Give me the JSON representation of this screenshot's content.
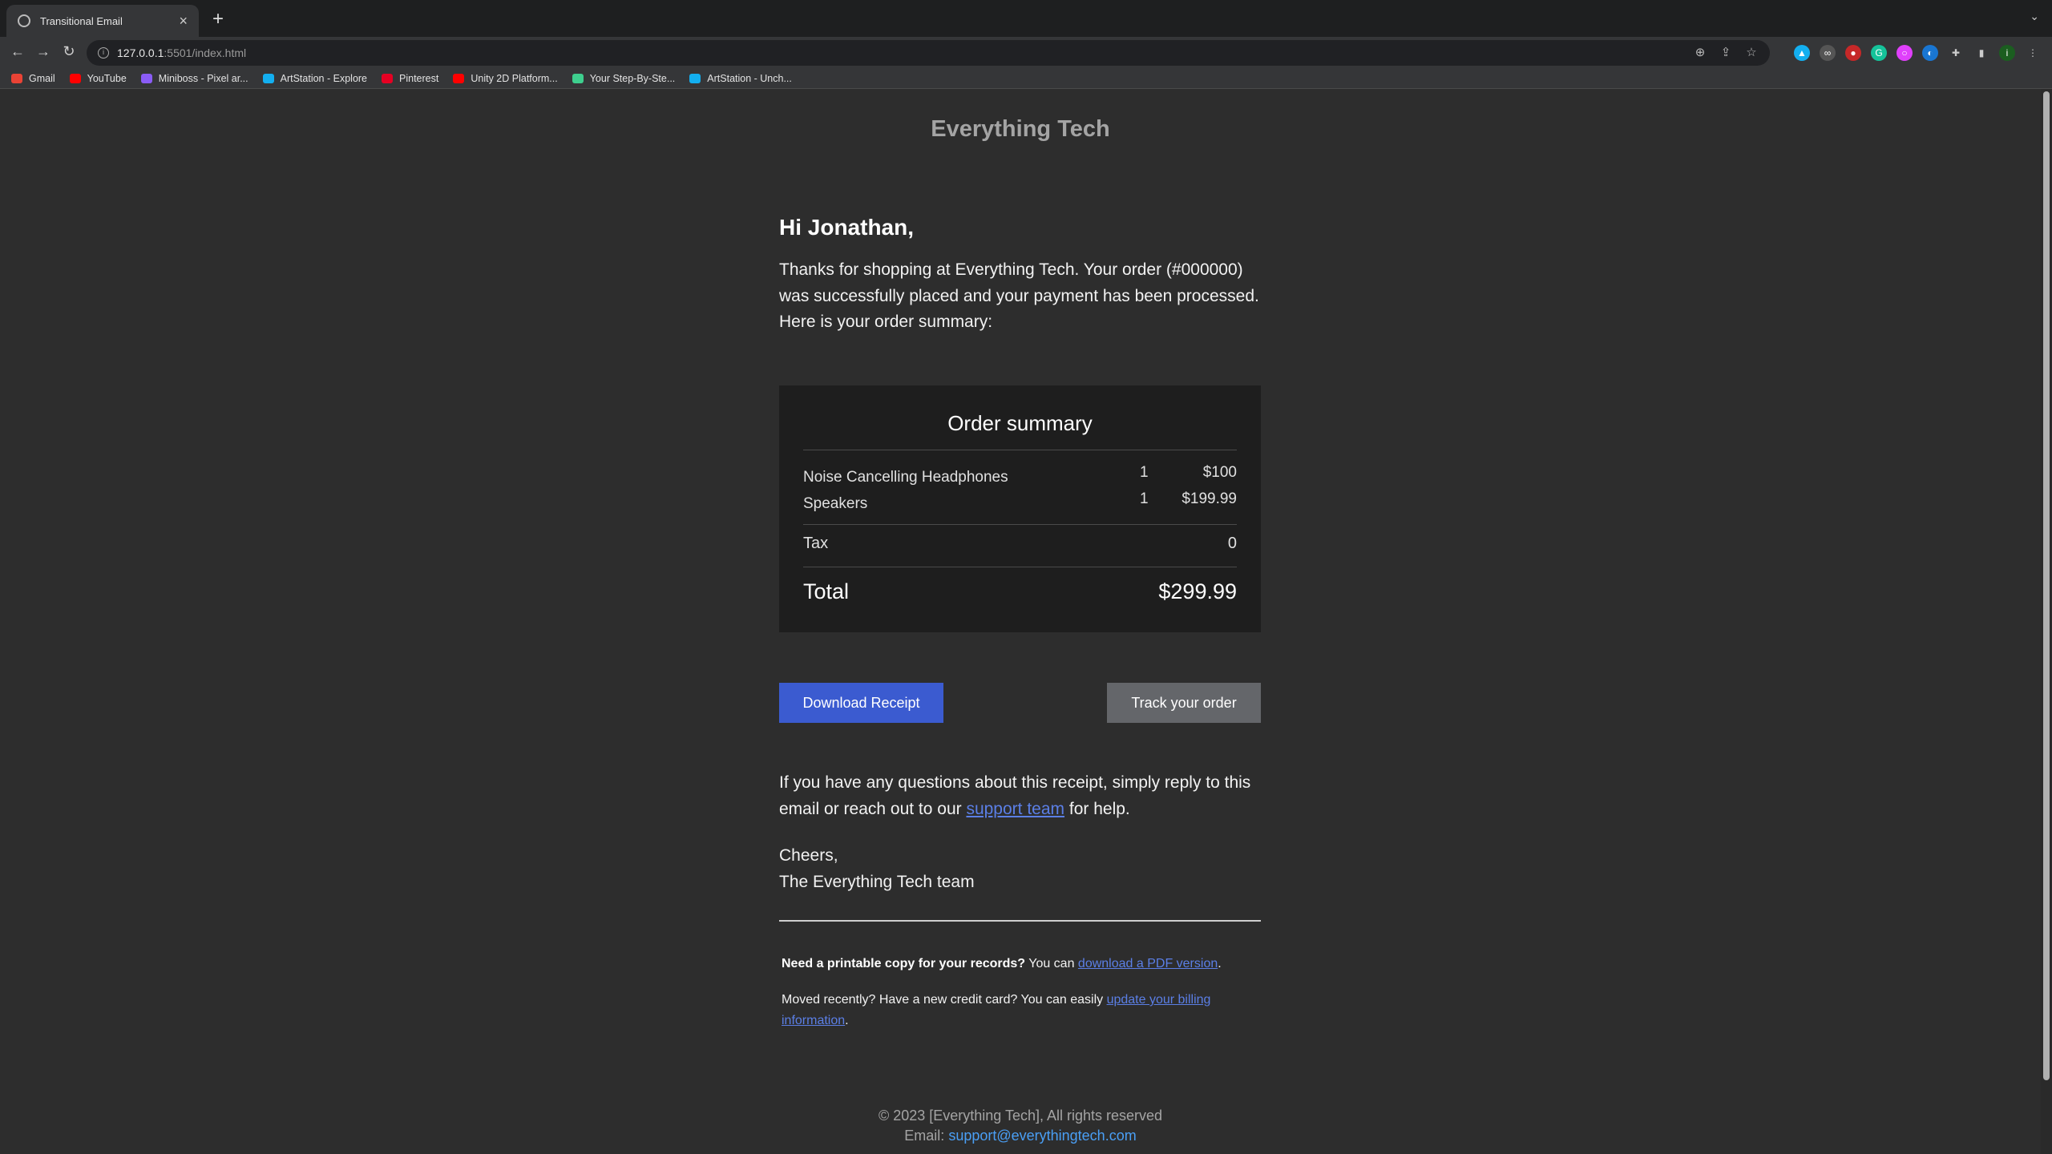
{
  "browser": {
    "tab_title": "Transitional Email",
    "url_host": "127.0.0.1",
    "url_path": ":5501/index.html",
    "bookmarks": [
      {
        "label": "Gmail",
        "color": "#ea4335"
      },
      {
        "label": "YouTube",
        "color": "#ff0000"
      },
      {
        "label": "Miniboss - Pixel ar...",
        "color": "#8a5cf6"
      },
      {
        "label": "ArtStation - Explore",
        "color": "#13aff0"
      },
      {
        "label": "Pinterest",
        "color": "#e60023"
      },
      {
        "label": "Unity 2D Platform...",
        "color": "#ff0000"
      },
      {
        "label": "Your Step-By-Ste...",
        "color": "#3ecf8e"
      },
      {
        "label": "ArtStation - Unch...",
        "color": "#13aff0"
      }
    ]
  },
  "email": {
    "brand": "Everything Tech",
    "greeting": "Hi Jonathan,",
    "intro": "Thanks for shopping at Everything Tech. Your order (#000000) was successfully placed and your payment has been processed. Here is your order summary:",
    "summary": {
      "title": "Order summary",
      "items": [
        {
          "name": "Noise Cancelling Headphones",
          "qty": "1",
          "price": "$100"
        },
        {
          "name": "Speakers",
          "qty": "1",
          "price": "$199.99"
        }
      ],
      "tax_label": "Tax",
      "tax_value": "0",
      "total_label": "Total",
      "total_value": "$299.99"
    },
    "download_button": "Download Receipt",
    "track_button": "Track your order",
    "help_before": "If you have any questions about this receipt, simply reply to this email or reach out to our ",
    "help_link": "support team",
    "help_after": " for help.",
    "signoff_1": "Cheers,",
    "signoff_2": "The Everything Tech team",
    "printable_bold": "Need a printable copy for your records?",
    "printable_text": " You can ",
    "printable_link": "download a PDF version",
    "printable_end": ".",
    "moved_text": "Moved recently? Have a new credit card? You can easily ",
    "moved_link": "update your billing information",
    "moved_end": "."
  },
  "footer": {
    "copyright": "© 2023 [Everything Tech], All rights reserved",
    "email_label": "Email: ",
    "email_value": "support@everythingtech.com"
  },
  "colors": {
    "page_bg": "#2d2d2d",
    "primary_button": "#3b5bd0",
    "secondary_button": "#64666a",
    "link": "#5b7fe6"
  }
}
